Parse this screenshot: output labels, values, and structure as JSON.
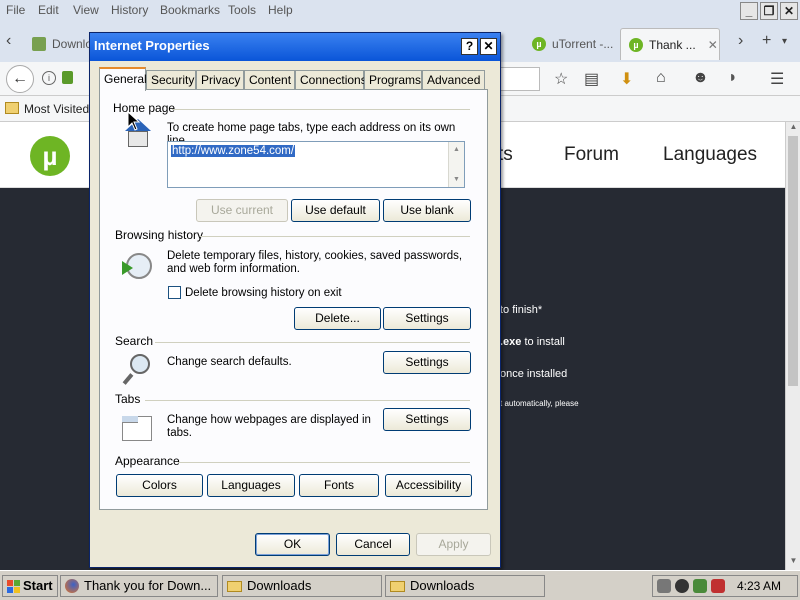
{
  "firefox": {
    "menu": [
      "File",
      "Edit",
      "View",
      "History",
      "Bookmarks",
      "Tools",
      "Help"
    ],
    "tabs": [
      {
        "label": "Downlo",
        "active": false
      },
      {
        "label": "uTorrent -...",
        "active": false
      },
      {
        "label": "Thank ...",
        "active": true
      }
    ],
    "bookmark_label": "Most Visited",
    "window_buttons": {
      "minimize": "_",
      "restore": "❐",
      "close": "✕"
    }
  },
  "page": {
    "logo_letter": "µ",
    "nav": [
      "ts",
      "Forum",
      "Languages"
    ],
    "lines": [
      {
        "text": "to finish*"
      },
      {
        "bold": ".exe",
        "text": " to install"
      },
      {
        "text": "once installed"
      },
      {
        "text": "t automatically, please"
      }
    ]
  },
  "dialog": {
    "title": "Internet Properties",
    "help_label": "?",
    "close_label": "✕",
    "tabs": [
      "General",
      "Security",
      "Privacy",
      "Content",
      "Connections",
      "Programs",
      "Advanced"
    ],
    "home_page": {
      "group_label": "Home page",
      "description": "To create home page tabs, type each address on its own line.",
      "url": "http://www.zone54.com/",
      "use_current": "Use current",
      "use_default": "Use default",
      "use_blank": "Use blank"
    },
    "browsing_history": {
      "group_label": "Browsing history",
      "description_line1": "Delete temporary files, history, cookies, saved passwords,",
      "description_line2": "and web form information.",
      "checkbox_label": "Delete browsing history on exit",
      "checkbox_checked": false,
      "delete_button": "Delete...",
      "settings_button": "Settings"
    },
    "search": {
      "group_label": "Search",
      "description": "Change search defaults.",
      "settings_button": "Settings"
    },
    "tabs_section": {
      "group_label": "Tabs",
      "description_line1": "Change how webpages are displayed in",
      "description_line2": "tabs.",
      "settings_button": "Settings"
    },
    "appearance": {
      "group_label": "Appearance",
      "buttons": [
        "Colors",
        "Languages",
        "Fonts",
        "Accessibility"
      ]
    },
    "footer": {
      "ok": "OK",
      "cancel": "Cancel",
      "apply": "Apply"
    }
  },
  "taskbar": {
    "start": "Start",
    "items": [
      "Thank you for Down...",
      "Downloads",
      "Downloads"
    ],
    "clock": "4:23 AM"
  },
  "colors": {
    "dialog_title_bar": "#0a55d8",
    "utorrent_green": "#6eb524",
    "active_tab_accent": "#e68b2c",
    "page_dark_bg": "#262a33"
  }
}
